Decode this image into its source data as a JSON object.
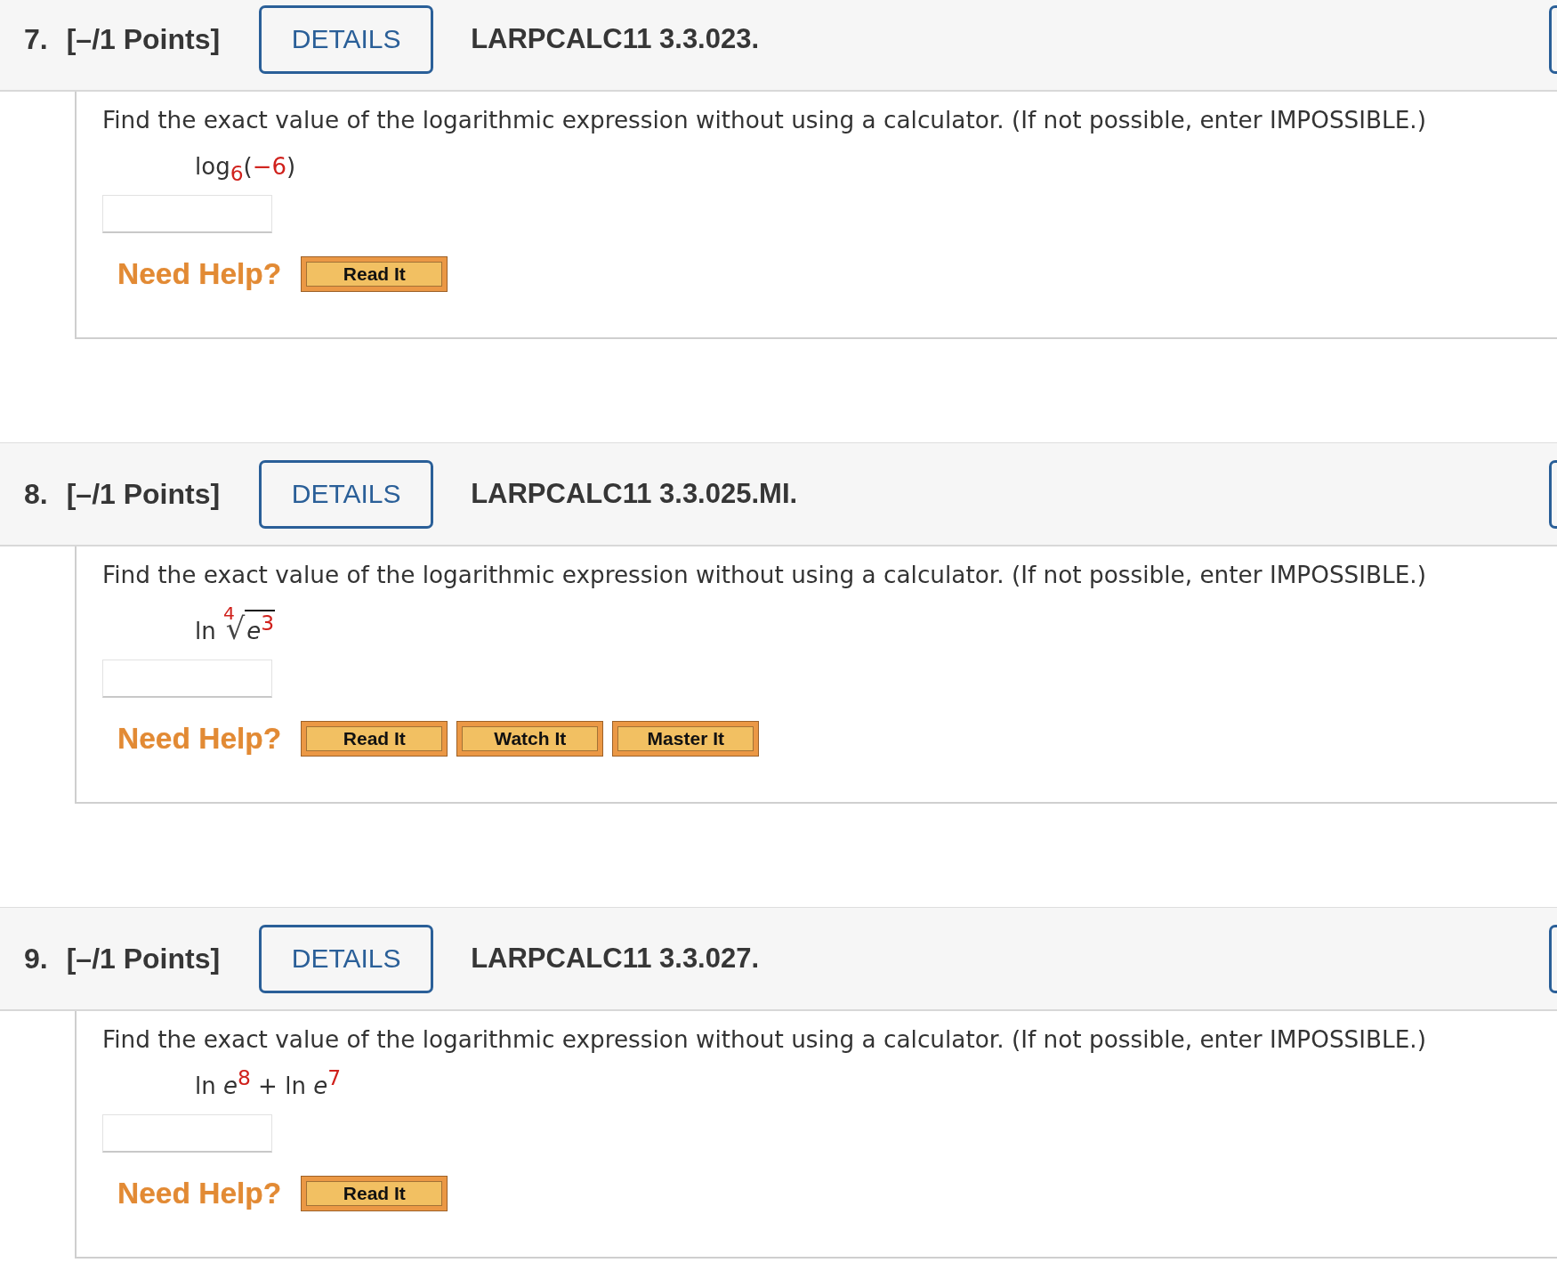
{
  "questions": [
    {
      "number": "7.",
      "points": "[–/1 Points]",
      "details_button": "DETAILS",
      "title": "LARPCALC11 3.3.023.",
      "prompt": "Find the exact value of the logarithmic expression without using a calculator. (If not possible, enter IMPOSSIBLE.)",
      "expression": [
        {
          "kind": "text",
          "text": "log"
        },
        {
          "kind": "sub",
          "text": "6",
          "color": "#d0211c"
        },
        {
          "kind": "text",
          "text": "("
        },
        {
          "kind": "text",
          "text": "−6",
          "color": "#d0211c"
        },
        {
          "kind": "text",
          "text": ")"
        }
      ],
      "help_label": "Need Help?",
      "help_buttons": [
        "Read It"
      ]
    },
    {
      "number": "8.",
      "points": "[–/1 Points]",
      "details_button": "DETAILS",
      "title": "LARPCALC11 3.3.025.MI.",
      "prompt": "Find the exact value of the logarithmic expression without using a calculator. (If not possible, enter IMPOSSIBLE.)",
      "expression": [
        {
          "kind": "text",
          "text": "ln "
        },
        {
          "kind": "root",
          "sign": "√",
          "index": {
            "text": "4",
            "color": "#d0211c"
          },
          "radicand": [
            {
              "kind": "var",
              "text": "e"
            },
            {
              "kind": "sup",
              "text": "3",
              "color": "#d0211c"
            }
          ]
        }
      ],
      "help_label": "Need Help?",
      "help_buttons": [
        "Read It",
        "Watch It",
        "Master It"
      ]
    },
    {
      "number": "9.",
      "points": "[–/1 Points]",
      "details_button": "DETAILS",
      "title": "LARPCALC11 3.3.027.",
      "prompt": "Find the exact value of the logarithmic expression without using a calculator. (If not possible, enter IMPOSSIBLE.)",
      "expression": [
        {
          "kind": "text",
          "text": "ln "
        },
        {
          "kind": "var",
          "text": "e"
        },
        {
          "kind": "sup",
          "text": "8",
          "color": "#d0211c"
        },
        {
          "kind": "text",
          "text": " + ln "
        },
        {
          "kind": "var",
          "text": "e"
        },
        {
          "kind": "sup",
          "text": "7",
          "color": "#d0211c"
        }
      ],
      "help_label": "Need Help?",
      "help_buttons": [
        "Read It"
      ]
    }
  ]
}
